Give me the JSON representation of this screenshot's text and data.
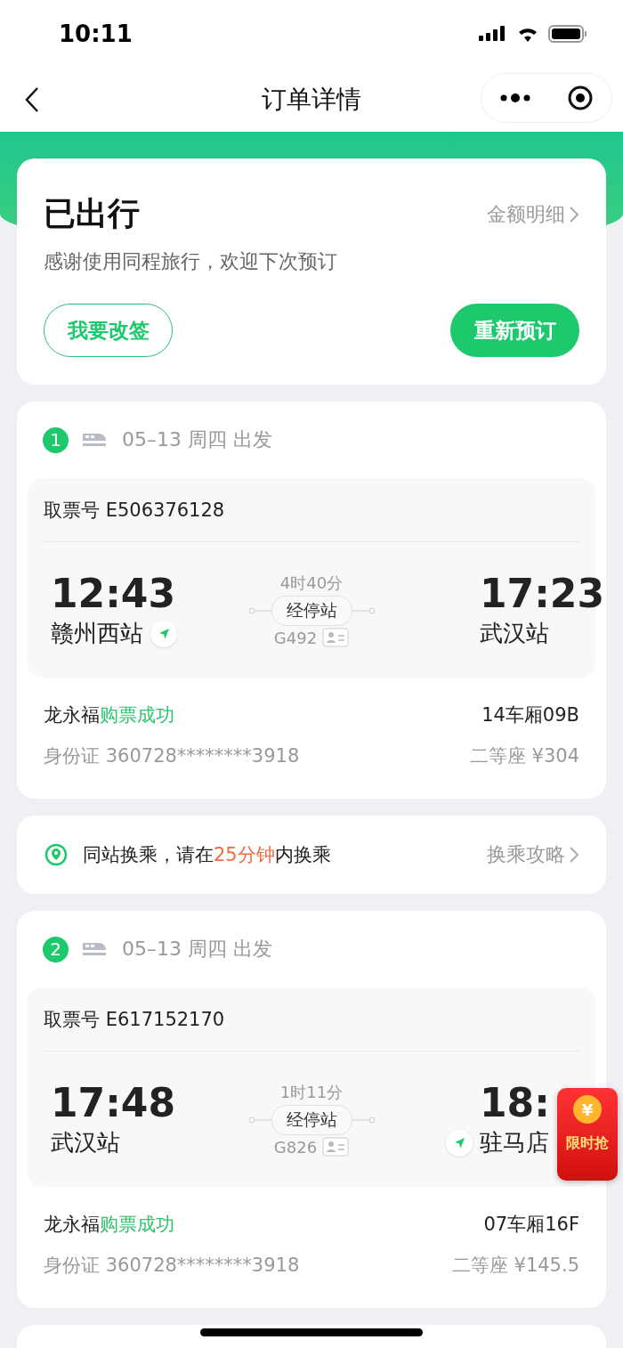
{
  "status_bar": {
    "time": "10:11"
  },
  "nav": {
    "title": "订单详情"
  },
  "summary": {
    "status": "已出行",
    "detail_link": "金额明细",
    "message": "感谢使用同程旅行，欢迎下次预订",
    "buttons": [
      {
        "label": "我要改签",
        "kind": "outline"
      },
      {
        "label": "重新预订",
        "kind": "filled"
      }
    ]
  },
  "journey": [
    {
      "kind": "ticket",
      "index": "1",
      "date": "05–13 周四 出发",
      "pickup_label": "取票号",
      "pickup_code": "E506376128",
      "depart": {
        "time": "12:43",
        "station": "赣州西站",
        "located": true
      },
      "arrive": {
        "time": "17:23",
        "station": "武汉站",
        "located": false
      },
      "duration": "4时40分",
      "stops": "经停站",
      "train": "G492",
      "passenger": {
        "name": "龙永福",
        "status": "购票成功",
        "seat": "14车厢09B",
        "id_label": "身份证",
        "id_number": "360728********3918",
        "seat_class": "二等座",
        "price": "¥304"
      }
    },
    {
      "kind": "transfer",
      "before": "同站换乘，请在",
      "highlight": "25分钟",
      "after": "内换乘",
      "link": "换乘攻略"
    },
    {
      "kind": "ticket",
      "index": "2",
      "date": "05–13 周四 出发",
      "pickup_label": "取票号",
      "pickup_code": "E617152170",
      "depart": {
        "time": "17:48",
        "station": "武汉站",
        "located": false
      },
      "arrive": {
        "time": "18:",
        "station": "驻马店",
        "located": true
      },
      "duration": "1时11分",
      "stops": "经停站",
      "train": "G826",
      "passenger": {
        "name": "龙永福",
        "status": "购票成功",
        "seat": "07车厢16F",
        "id_label": "身份证",
        "id_number": "360728********3918",
        "seat_class": "二等座",
        "price": "¥145.5"
      }
    }
  ],
  "promo": {
    "coin": "¥",
    "label": "限时抢"
  }
}
